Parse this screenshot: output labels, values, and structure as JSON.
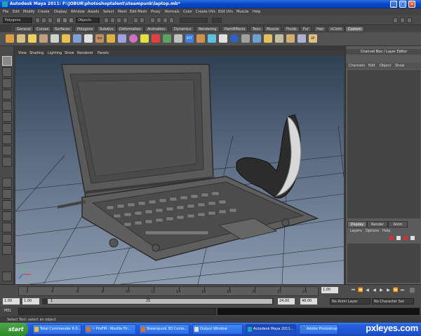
{
  "window": {
    "title": "Autodesk Maya 2011: F:\\JOBUR\\photoshoptalent\\steampunk\\laptop.mb*"
  },
  "menu": [
    "File",
    "Edit",
    "Modify",
    "Create",
    "Display",
    "Window",
    "Assets",
    "Select",
    "Mesh",
    "Edit Mesh",
    "Proxy",
    "Normals",
    "Color",
    "Create UVs",
    "Edit UVs",
    "Muscle",
    "Help"
  ],
  "statusline": {
    "mode": "Polygons",
    "selection_field": "Objects"
  },
  "shelf_tabs": [
    "General",
    "Curves",
    "Surfaces",
    "Polygons",
    "Subdivs",
    "Deformation",
    "Animation",
    "Dynamics",
    "Rendering",
    "PaintEffects",
    "Toon",
    "Muscle",
    "Fluids",
    "Fur",
    "Hair",
    "nCloth",
    "Custom"
  ],
  "active_shelf_tab": "Custom",
  "shelf_icon_labels": {
    "fmt": "fmt",
    "ifft": "IFFT",
    "ep": "EP"
  },
  "viewport_menu": [
    "View",
    "Shading",
    "Lighting",
    "Show",
    "Renderer",
    "Panels"
  ],
  "channel_box": {
    "title": "Channel Box / Layer Editor",
    "menu": [
      "Channels",
      "Edit",
      "Object",
      "Show"
    ]
  },
  "layer_editor": {
    "tabs": [
      "Display",
      "Render",
      "Anim"
    ],
    "active_tab": "Display",
    "menu": [
      "Layers",
      "Options",
      "Help"
    ]
  },
  "time_slider": {
    "ticks": [
      "2",
      "4",
      "6",
      "8",
      "10",
      "12",
      "14",
      "16",
      "18",
      "20",
      "22",
      "24"
    ],
    "current_frame": "1.00"
  },
  "range_slider": {
    "start": "1.00",
    "start2": "1.00",
    "range_start": "1",
    "range_end": "25",
    "end": "24.00",
    "end2": "48.00",
    "anim_layer": "No Anim Layer",
    "character_set": "No Character Set"
  },
  "command_line": {
    "label": "MEL"
  },
  "help_line": {
    "text": "Select Tool: select an object"
  },
  "taskbar": {
    "start": "start",
    "buttons": [
      {
        "label": "Total Commander 6.0...",
        "active": false
      },
      {
        "label": "~ ProFM - Mozilla Fir...",
        "active": false
      },
      {
        "label": "Steampunk 3D Conte...",
        "active": false
      },
      {
        "label": "Output Window",
        "active": false
      },
      {
        "label": "Autodesk Maya 2011...",
        "active": true
      },
      {
        "label": "Adobe Photoshop",
        "active": false
      }
    ],
    "watermark": "pxleyes.com"
  },
  "colors": {
    "titlebar": "#0a46c8",
    "maya_bg": "#444444",
    "viewport_top": "#2e3e52",
    "viewport_bottom": "#8c9bb0",
    "taskbar": "#245ee0",
    "start_green": "#3a9a36"
  }
}
